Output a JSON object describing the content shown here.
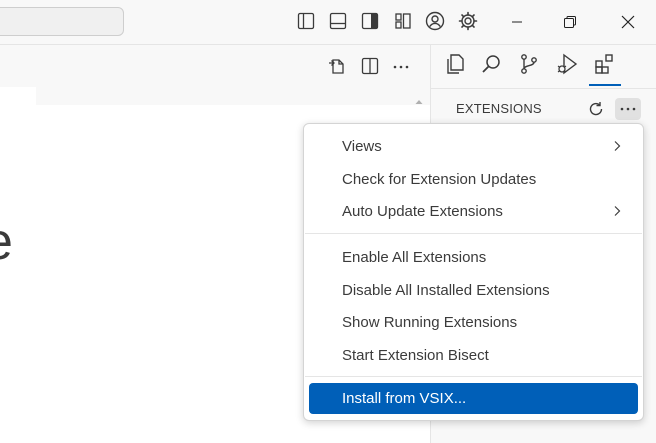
{
  "sidebar": {
    "title": "EXTENSIONS"
  },
  "menu": {
    "items": [
      {
        "label": "Views",
        "submenu": true
      },
      {
        "label": "Check for Extension Updates",
        "submenu": false
      },
      {
        "label": "Auto Update Extensions",
        "submenu": true
      },
      {
        "label": "Enable All Extensions",
        "submenu": false
      },
      {
        "label": "Disable All Installed Extensions",
        "submenu": false
      },
      {
        "label": "Show Running Extensions",
        "submenu": false
      },
      {
        "label": "Start Extension Bisect",
        "submenu": false
      },
      {
        "label": "Install from VSIX...",
        "submenu": false,
        "selected": true
      }
    ]
  },
  "editor": {
    "visible_glyph": "e"
  },
  "colors": {
    "accent": "#005fb8",
    "text": "#3b3b3b",
    "chrome": "#f8f8f8"
  },
  "icons": {
    "titlebar": [
      "toggle-primary-sidebar-icon",
      "toggle-panel-icon",
      "toggle-secondary-sidebar-icon",
      "customize-layout-icon",
      "accounts-icon",
      "settings-gear-icon"
    ],
    "window": [
      "minimize-icon",
      "restore-icon",
      "close-icon"
    ],
    "editor_toolbar": [
      "open-changes-icon",
      "split-editor-icon",
      "more-actions-icon"
    ],
    "activity": [
      "explorer-icon",
      "search-icon",
      "source-control-icon",
      "run-debug-icon",
      "extensions-icon"
    ]
  }
}
